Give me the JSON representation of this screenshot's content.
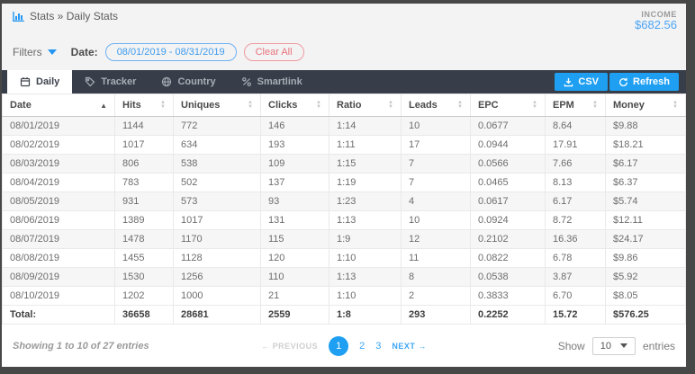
{
  "colors": {
    "accent_blue": "#1e9ff2",
    "link_blue": "#3da5f4",
    "tabbar_dark": "#373e49",
    "danger_red": "#e9737d",
    "income_blue": "#4ba4f5"
  },
  "header": {
    "breadcrumb": "Stats » Daily Stats",
    "income_label": "INCOME",
    "income_value": "$682.56"
  },
  "filters": {
    "label": "Filters",
    "date_label": "Date:",
    "date_range": "08/01/2019 - 08/31/2019",
    "clear_all_label": "Clear All"
  },
  "tabs": [
    {
      "label": "Daily",
      "icon": "calendar-icon",
      "active": true
    },
    {
      "label": "Tracker",
      "icon": "tag-icon",
      "active": false
    },
    {
      "label": "Country",
      "icon": "globe-icon",
      "active": false
    },
    {
      "label": "Smartlink",
      "icon": "percent-icon",
      "active": false
    }
  ],
  "toolbar": {
    "csv_label": "CSV",
    "refresh_label": "Refresh"
  },
  "table": {
    "columns": [
      {
        "label": "Date",
        "sort": "asc"
      },
      {
        "label": "Hits",
        "sort": "none"
      },
      {
        "label": "Uniques",
        "sort": "none"
      },
      {
        "label": "Clicks",
        "sort": "none"
      },
      {
        "label": "Ratio",
        "sort": "none"
      },
      {
        "label": "Leads",
        "sort": "none"
      },
      {
        "label": "EPC",
        "sort": "none"
      },
      {
        "label": "EPM",
        "sort": "none"
      },
      {
        "label": "Money",
        "sort": "none"
      }
    ],
    "rows": [
      [
        "08/01/2019",
        "1144",
        "772",
        "146",
        "1:14",
        "10",
        "0.0677",
        "8.64",
        "$9.88"
      ],
      [
        "08/02/2019",
        "1017",
        "634",
        "193",
        "1:11",
        "17",
        "0.0944",
        "17.91",
        "$18.21"
      ],
      [
        "08/03/2019",
        "806",
        "538",
        "109",
        "1:15",
        "7",
        "0.0566",
        "7.66",
        "$6.17"
      ],
      [
        "08/04/2019",
        "783",
        "502",
        "137",
        "1:19",
        "7",
        "0.0465",
        "8.13",
        "$6.37"
      ],
      [
        "08/05/2019",
        "931",
        "573",
        "93",
        "1:23",
        "4",
        "0.0617",
        "6.17",
        "$5.74"
      ],
      [
        "08/06/2019",
        "1389",
        "1017",
        "131",
        "1:13",
        "10",
        "0.0924",
        "8.72",
        "$12.11"
      ],
      [
        "08/07/2019",
        "1478",
        "1170",
        "115",
        "1:9",
        "12",
        "0.2102",
        "16.36",
        "$24.17"
      ],
      [
        "08/08/2019",
        "1455",
        "1128",
        "120",
        "1:10",
        "11",
        "0.0822",
        "6.78",
        "$9.86"
      ],
      [
        "08/09/2019",
        "1530",
        "1256",
        "110",
        "1:13",
        "8",
        "0.0538",
        "3.87",
        "$5.92"
      ],
      [
        "08/10/2019",
        "1202",
        "1000",
        "21",
        "1:10",
        "2",
        "0.3833",
        "6.70",
        "$8.05"
      ]
    ],
    "total_label": "Total:",
    "total": [
      "36658",
      "28681",
      "2559",
      "1:8",
      "293",
      "0.2252",
      "15.72",
      "$576.25"
    ]
  },
  "footer": {
    "showing_text": "Showing 1 to 10 of 27 entries",
    "previous_label": "← PREVIOUS",
    "pages": [
      "1",
      "2",
      "3"
    ],
    "active_page": "1",
    "next_label": "NEXT →",
    "show_label": "Show",
    "page_size": "10",
    "entries_label": "entries"
  }
}
